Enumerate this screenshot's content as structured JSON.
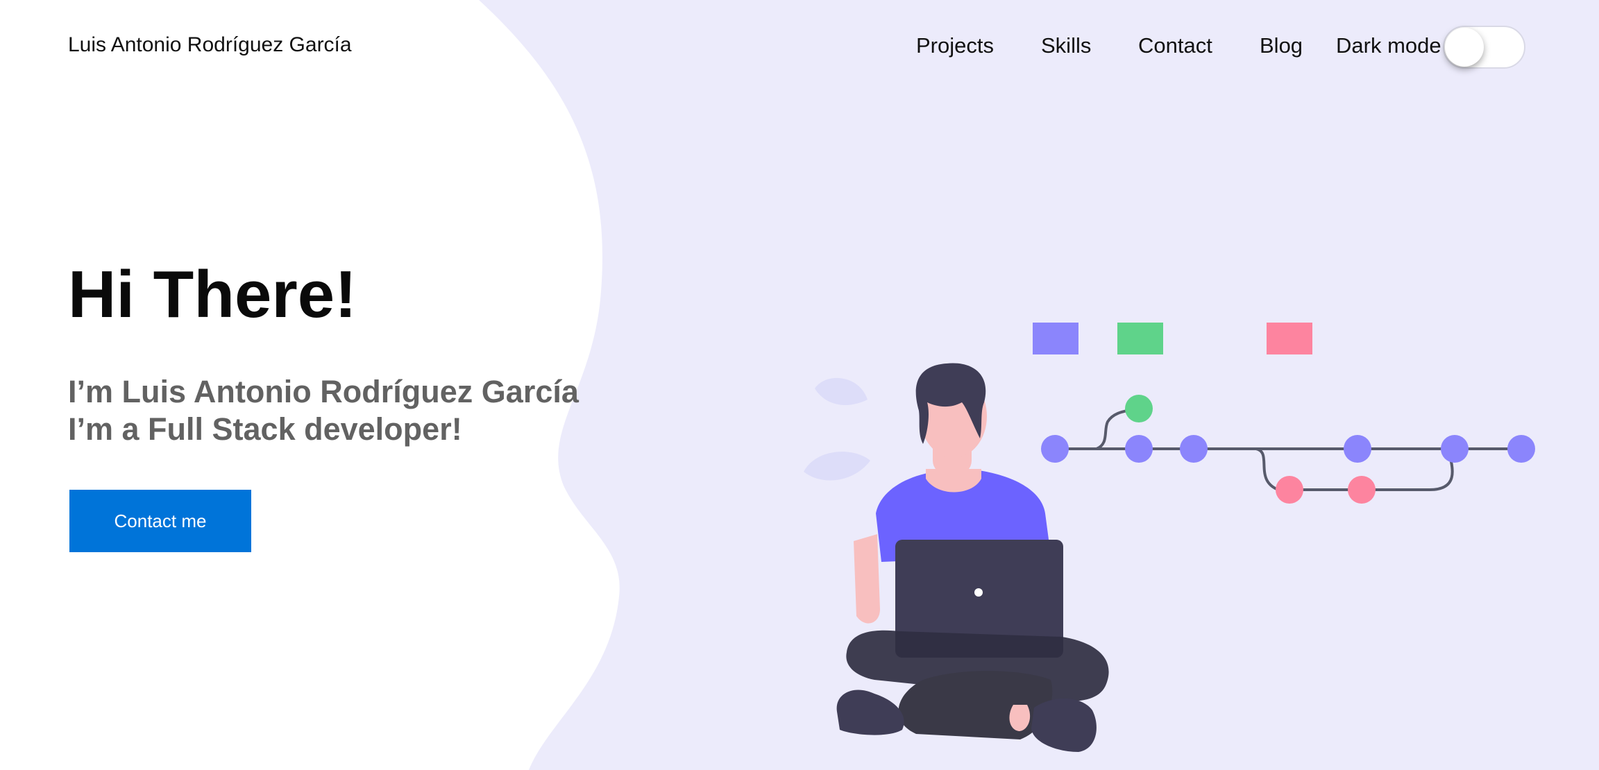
{
  "header": {
    "brand": "Luis Antonio Rodríguez García",
    "nav": {
      "projects": "Projects",
      "skills": "Skills",
      "contact": "Contact",
      "blog": "Blog"
    },
    "dark_mode": {
      "label": "Dark mode",
      "enabled": false
    }
  },
  "hero": {
    "title": "Hi There!",
    "subtitle_line1": "I’m Luis Antonio Rodríguez García",
    "subtitle_line2": "I’m a Full Stack developer!",
    "cta_label": "Contact me"
  },
  "illustration": {
    "icon": "developer-with-laptop-git-graph",
    "colors": {
      "primary": "#6c63ff",
      "node": "#8b85fc",
      "green": "#5fd38a",
      "pink": "#fd849f",
      "dark": "#3f3d56",
      "skin": "#f8bfbf"
    }
  },
  "colors": {
    "background": "#ecebfb",
    "panel": "#ffffff",
    "accent": "#0074d9"
  }
}
